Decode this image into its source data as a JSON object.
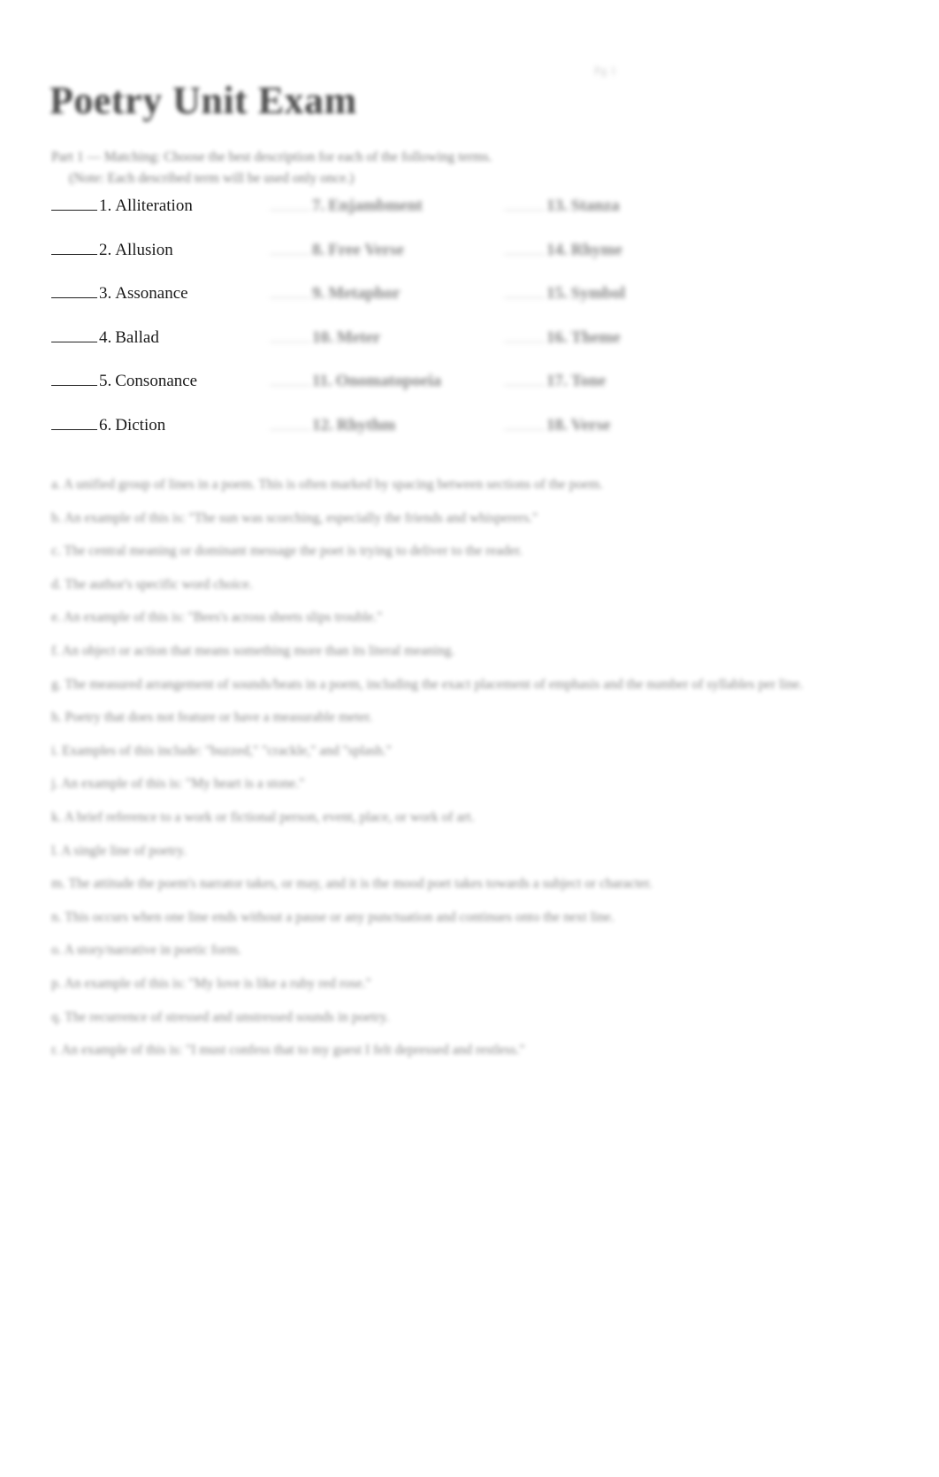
{
  "document": {
    "title": "Poetry Unit Exam",
    "page_marker": "Pg 1"
  },
  "part1": {
    "instructions_line1": "Part 1 — Matching: Choose the best description for each of the following terms.",
    "instructions_line2": "(Note: Each described term will be used only once.)"
  },
  "matching": {
    "column1": [
      {
        "number": "1.",
        "term": "Alliteration"
      },
      {
        "number": "2.",
        "term": "Allusion"
      },
      {
        "number": "3.",
        "term": "Assonance"
      },
      {
        "number": "4.",
        "term": "Ballad"
      },
      {
        "number": "5.",
        "term": "Consonance"
      },
      {
        "number": "6.",
        "term": "Diction"
      }
    ],
    "column2": [
      {
        "number": "7.",
        "term": "Enjambment"
      },
      {
        "number": "8.",
        "term": "Free Verse"
      },
      {
        "number": "9.",
        "term": "Metaphor"
      },
      {
        "number": "10.",
        "term": "Meter"
      },
      {
        "number": "11.",
        "term": "Onomatopoeia"
      },
      {
        "number": "12.",
        "term": "Rhythm"
      }
    ],
    "column3": [
      {
        "number": "13.",
        "term": "Stanza"
      },
      {
        "number": "14.",
        "term": "Rhyme"
      },
      {
        "number": "15.",
        "term": "Symbol"
      },
      {
        "number": "16.",
        "term": "Theme"
      },
      {
        "number": "17.",
        "term": "Tone"
      },
      {
        "number": "18.",
        "term": "Verse"
      }
    ]
  },
  "definitions": [
    {
      "letter": "a.",
      "text": "A unified group of lines in a poem. This is often marked by spacing between sections of the poem."
    },
    {
      "letter": "b.",
      "text": "An example of this is: \"The sun was scorching, especially the friends and whisperers.\""
    },
    {
      "letter": "c.",
      "text": "The central meaning or dominant message the poet is trying to deliver to the reader."
    },
    {
      "letter": "d.",
      "text": "The author's specific word choice."
    },
    {
      "letter": "e.",
      "text": "An example of this is: \"Bees's across sheets slips trouble.\""
    },
    {
      "letter": "f.",
      "text": "An object or action that means something more than its literal meaning."
    },
    {
      "letter": "g.",
      "text": "The measured arrangement of sounds/beats in a poem, including the exact placement of emphasis and the number of syllables per line.",
      "continuation": "number of syllables per line."
    },
    {
      "letter": "h.",
      "text": "Poetry that does not feature or have a measurable meter."
    },
    {
      "letter": "i.",
      "text": "Examples of this include: \"buzzed,\" \"crackle,\" and \"splash.\""
    },
    {
      "letter": "j.",
      "text": "An example of this is: \"My heart is a stone.\""
    },
    {
      "letter": "k.",
      "text": "A brief reference to a work or fictional person, event, place, or work of art."
    },
    {
      "letter": "l.",
      "text": "A single line of poetry."
    },
    {
      "letter": "m.",
      "text": "The attitude the poem's narrator takes, or may, and it is the mood poet takes towards a subject or character."
    },
    {
      "letter": "n.",
      "text": "This occurs when one line ends without a pause or any punctuation and continues onto the next line."
    },
    {
      "letter": "o.",
      "text": "A story/narrative in poetic form."
    },
    {
      "letter": "p.",
      "text": "An example of this is: \"My love is like a ruby red rose.\""
    },
    {
      "letter": "q.",
      "text": "The recurrence of stressed and unstressed sounds in poetry."
    },
    {
      "letter": "r.",
      "text": "An example of this is: \"I must confess that to my guest I felt depressed and restless.\""
    }
  ]
}
